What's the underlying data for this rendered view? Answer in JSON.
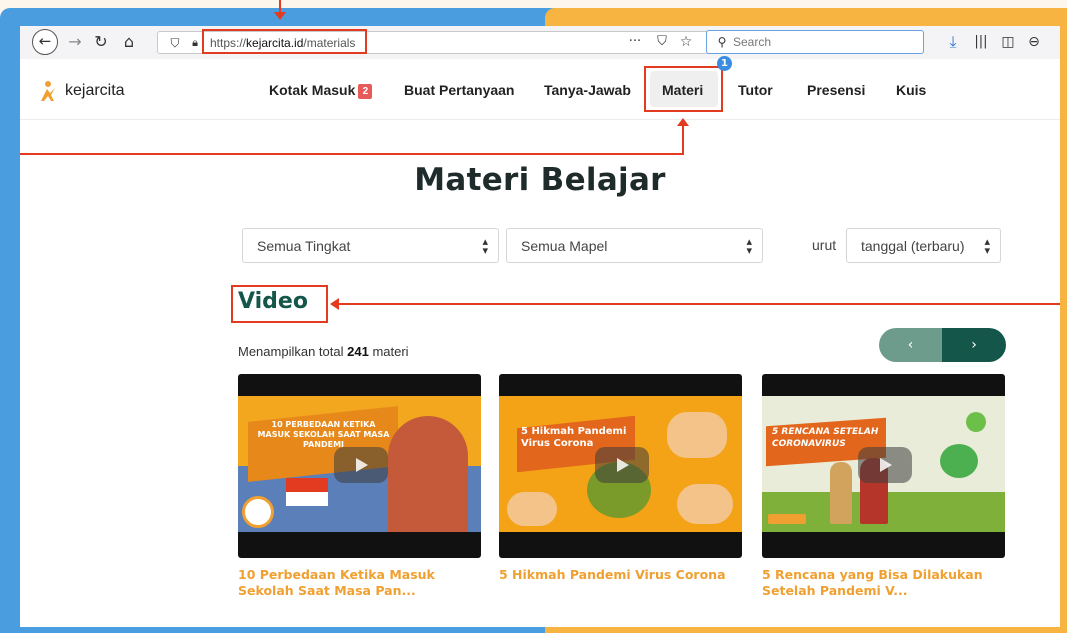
{
  "browser": {
    "url_prefix": "https://",
    "url_domain": "kejarcita.id",
    "url_path": "/materials",
    "search_placeholder": "Search",
    "icons": [
      "back-icon",
      "forward-icon",
      "reload-icon",
      "home-icon",
      "shield-icon",
      "lock-icon",
      "more-icon",
      "pocket-icon",
      "star-icon",
      "search-icon",
      "download-icon",
      "library-icon",
      "sidebar-icon",
      "account-icon"
    ]
  },
  "site": {
    "brand": "kejarcita",
    "nav": {
      "inbox": "Kotak Masuk",
      "inbox_badge": "2",
      "ask": "Buat Pertanyaan",
      "qa": "Tanya-Jawab",
      "materials": "Materi",
      "tutor": "Tutor",
      "attendance": "Presensi",
      "quiz": "Kuis"
    },
    "step_number": "1"
  },
  "main": {
    "title": "Materi Belajar",
    "filter_level": "Semua Tingkat",
    "filter_subject": "Semua Mapel",
    "sort_label": "urut",
    "sort_value": "tanggal (terbaru)",
    "section_title": "Video",
    "count_prefix": "Menampilkan total",
    "count_value": "241",
    "count_suffix": "materi",
    "prev": "‹",
    "next": "›",
    "videos": [
      {
        "thumb_text": "10 PERBEDAAN KETIKA MASUK SEKOLAH SAAT MASA PANDEMI",
        "title": "10 Perbedaan Ketika Masuk Sekolah Saat Masa Pan..."
      },
      {
        "thumb_text": "5 Hikmah Pandemi Virus Corona",
        "title": "5 Hikmah Pandemi Virus Corona"
      },
      {
        "thumb_text": "5 RENCANA SETELAH CORONAVIRUS",
        "title": "5 Rencana yang Bisa Dilakukan Setelah Pandemi V..."
      }
    ]
  },
  "colors": {
    "accent_red": "#e23b1f",
    "brand_green": "#14574a",
    "title_orange": "#f0a030",
    "bg_blue": "#4a9ee0",
    "bg_orange": "#f7b441"
  }
}
